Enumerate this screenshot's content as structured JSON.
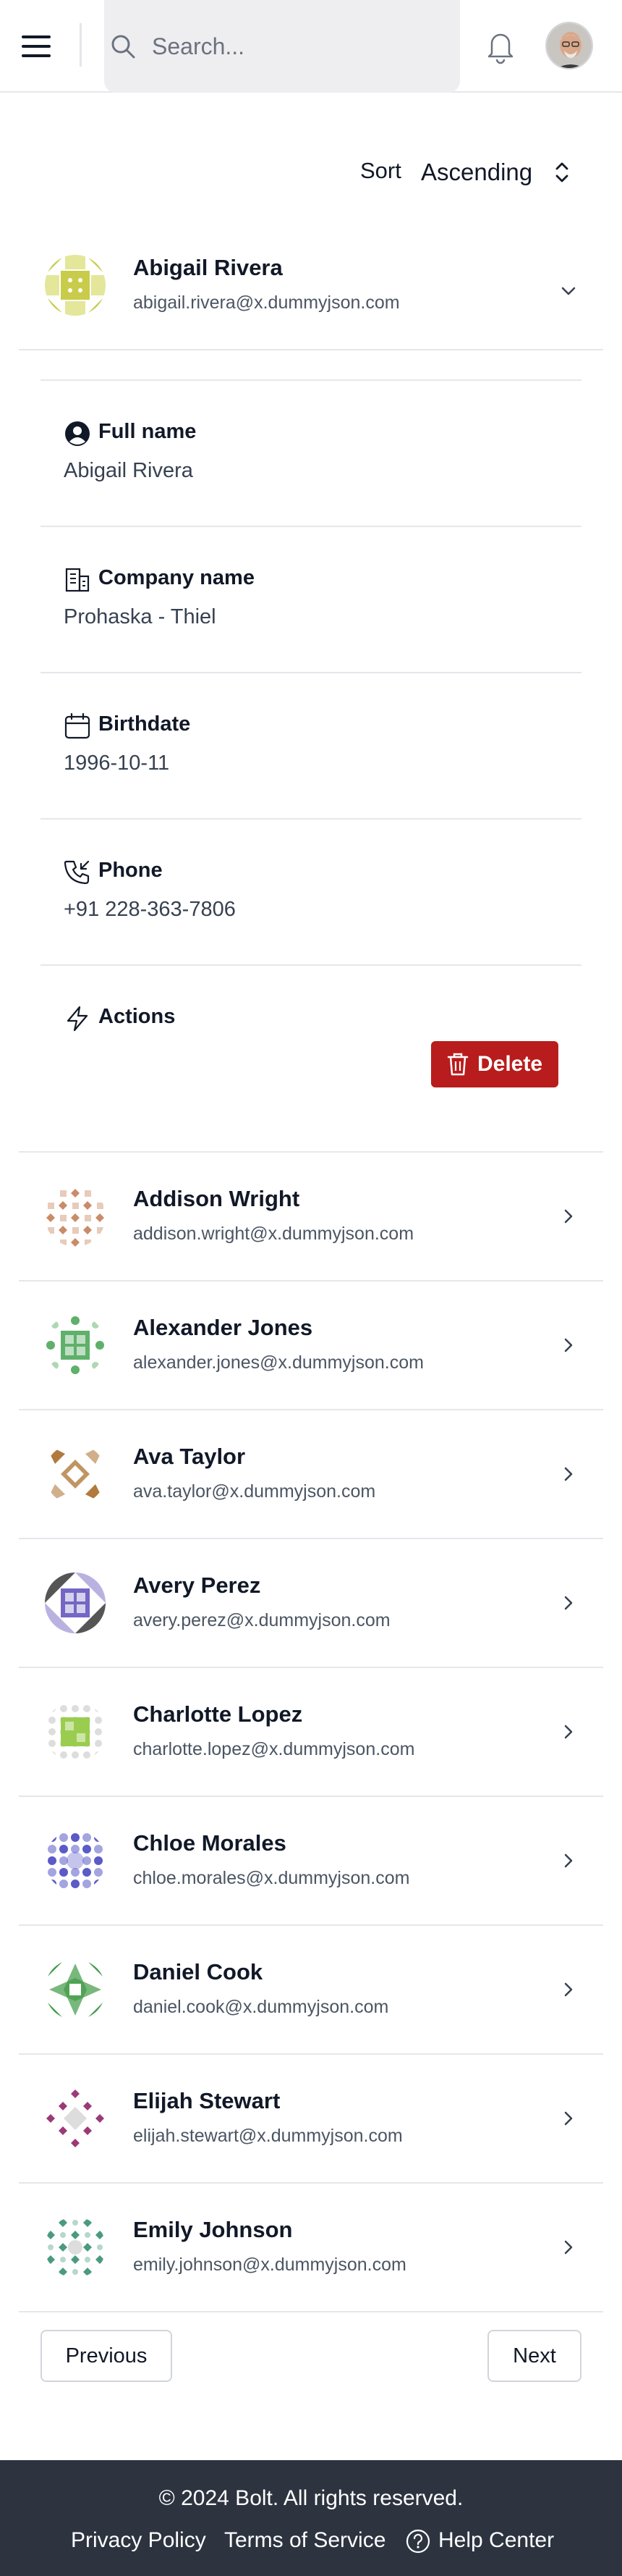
{
  "header": {
    "search_placeholder": "Search...",
    "icons": [
      "menu-icon",
      "search-icon",
      "bell-icon"
    ]
  },
  "sort": {
    "label": "Sort",
    "selected": "Ascending"
  },
  "expanded_user": {
    "name": "Abigail Rivera",
    "email": "abigail.rivera@x.dummyjson.com",
    "fields": [
      {
        "label": "Full name",
        "value": "Abigail Rivera",
        "icon": "user-circle-icon"
      },
      {
        "label": "Company name",
        "value": "Prohaska - Thiel",
        "icon": "building-icon"
      },
      {
        "label": "Birthdate",
        "value": "1996-10-11",
        "icon": "calendar-icon"
      },
      {
        "label": "Phone",
        "value": "+91 228-363-7806",
        "icon": "phone-icon"
      },
      {
        "label": "Actions",
        "value": "",
        "icon": "bolt-icon"
      }
    ],
    "delete_label": "Delete"
  },
  "users": [
    {
      "name": "Addison Wright",
      "email": "addison.wright@x.dummyjson.com",
      "color": "#c98b68"
    },
    {
      "name": "Alexander Jones",
      "email": "alexander.jones@x.dummyjson.com",
      "color": "#5fb06a"
    },
    {
      "name": "Ava Taylor",
      "email": "ava.taylor@x.dummyjson.com",
      "color": "#b07a3c"
    },
    {
      "name": "Avery Perez",
      "email": "avery.perez@x.dummyjson.com",
      "color": "#7466c4"
    },
    {
      "name": "Charlotte Lopez",
      "email": "charlotte.lopez@x.dummyjson.com",
      "color": "#9acd4f"
    },
    {
      "name": "Chloe Morales",
      "email": "chloe.morales@x.dummyjson.com",
      "color": "#5a5ac8"
    },
    {
      "name": "Daniel Cook",
      "email": "daniel.cook@x.dummyjson.com",
      "color": "#3f9a45"
    },
    {
      "name": "Elijah Stewart",
      "email": "elijah.stewart@x.dummyjson.com",
      "color": "#9b3a78"
    },
    {
      "name": "Emily Johnson",
      "email": "emily.johnson@x.dummyjson.com",
      "color": "#4a9a82"
    }
  ],
  "pagination": {
    "previous": "Previous",
    "next": "Next"
  },
  "footer": {
    "copyright": "© 2024 Bolt. All rights reserved.",
    "privacy": "Privacy Policy",
    "terms": "Terms of Service",
    "help": "Help Center"
  },
  "colors": {
    "accent_danger": "#b91c1c",
    "footer_bg": "#2d3440",
    "search_bg": "#eeeef0",
    "abigail_avatar": "#c8cc4a"
  }
}
